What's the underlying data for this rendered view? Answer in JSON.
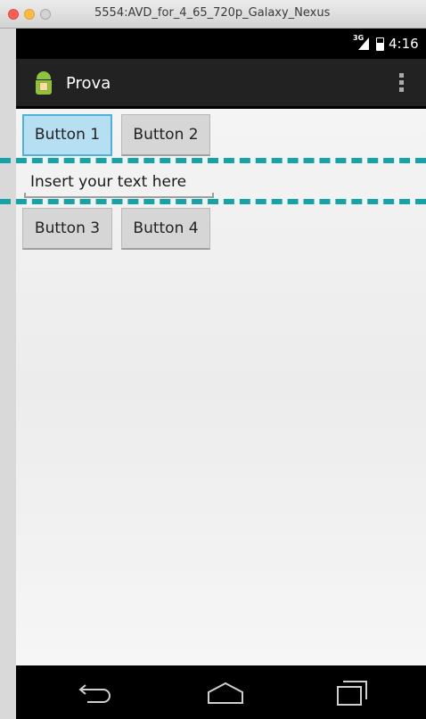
{
  "window": {
    "title": "5554:AVD_for_4_65_720p_Galaxy_Nexus"
  },
  "status_bar": {
    "network": "3G",
    "time": "4:16"
  },
  "action_bar": {
    "app_title": "Prova",
    "app_icon": "android-icon",
    "overflow_icon": "overflow-menu-icon"
  },
  "content": {
    "button1_label": "Button 1",
    "button2_label": "Button 2",
    "text_placeholder": "Insert your text here",
    "button3_label": "Button 3",
    "button4_label": "Button 4"
  },
  "nav_bar": {
    "back_icon": "back-icon",
    "home_icon": "home-icon",
    "recent_icon": "recent-apps-icon"
  },
  "colors": {
    "focus_accent": "#4db1de",
    "guide_line": "#13a3a8",
    "action_bar": "#222222"
  }
}
